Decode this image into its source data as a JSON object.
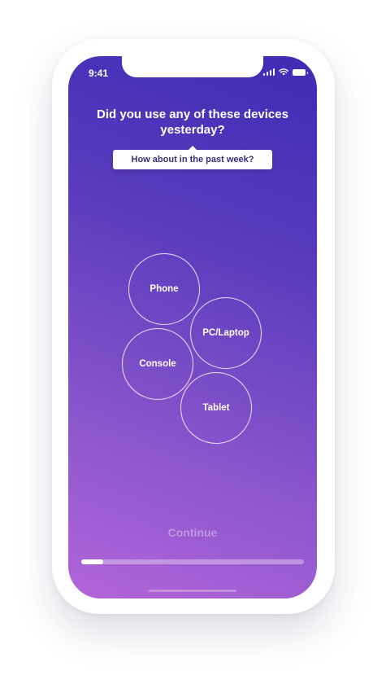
{
  "status_bar": {
    "time": "9:41",
    "icons": [
      "signal-icon",
      "wifi-icon",
      "battery-icon"
    ]
  },
  "question": "Did you use any of these devices yesterday?",
  "hint": "How about in the past week?",
  "devices": [
    {
      "label": "Phone"
    },
    {
      "label": "PC/Laptop"
    },
    {
      "label": "Console"
    },
    {
      "label": "Tablet"
    }
  ],
  "continue_label": "Continue",
  "progress": {
    "fraction": 0.1
  },
  "colors": {
    "gradient_top": "#3f2bb5",
    "gradient_bottom": "#b265d8",
    "text": "#ffffff",
    "hint_text": "#3a2d7a"
  }
}
